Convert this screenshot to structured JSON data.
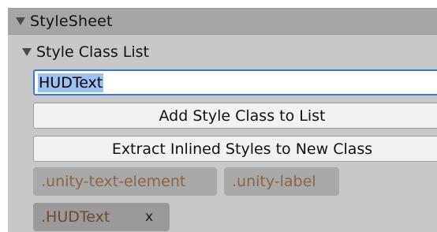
{
  "stylesheet": {
    "title": "StyleSheet",
    "class_list": {
      "title": "Style Class List",
      "input_value": "HUDText",
      "add_button_label": "Add Style Class to List",
      "extract_button_label": "Extract Inlined Styles to New Class",
      "classes": [
        {
          "label": ".unity-text-element"
        },
        {
          "label": ".unity-label"
        },
        {
          "label": ".HUDText",
          "remove_label": "x"
        }
      ]
    }
  },
  "colors": {
    "panel_background": "#c8c8c8",
    "header_background": "#a6a6a6",
    "selection_highlight": "#9cc2f3",
    "focus_border": "#3a78d6",
    "chip_text": "#8a6447"
  }
}
